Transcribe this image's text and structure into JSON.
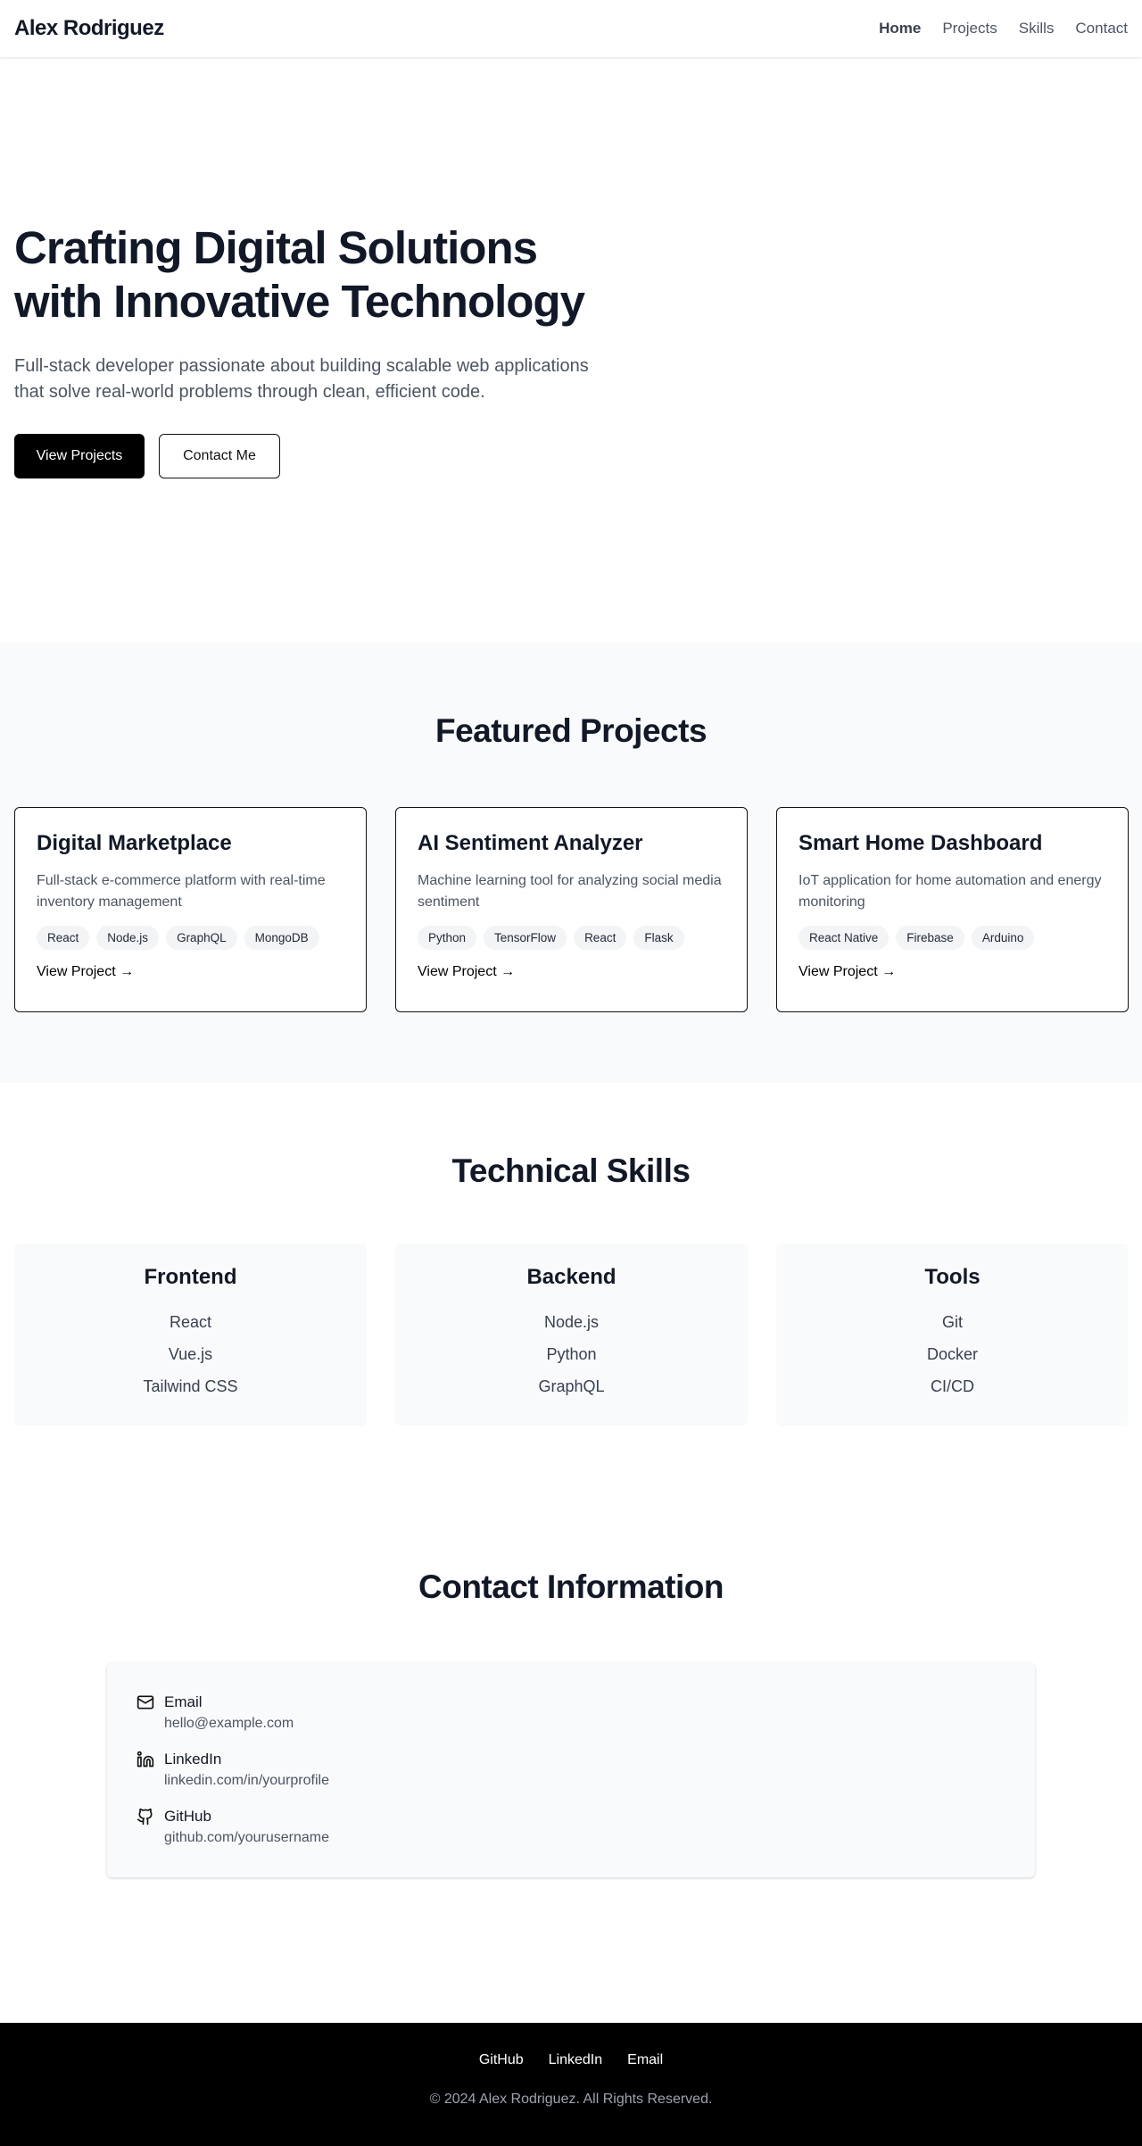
{
  "header": {
    "brand": "Alex Rodriguez",
    "nav": [
      {
        "label": "Home"
      },
      {
        "label": "Projects"
      },
      {
        "label": "Skills"
      },
      {
        "label": "Contact"
      }
    ]
  },
  "hero": {
    "title_line1": "Crafting Digital Solutions",
    "title_line2": "with Innovative Technology",
    "subtitle": "Full-stack developer passionate about building scalable web applications that solve real-world problems through clean, efficient code.",
    "primary_button": "View Projects",
    "secondary_button": "Contact Me"
  },
  "projects": {
    "title": "Featured Projects",
    "items": [
      {
        "title": "Digital Marketplace",
        "description": "Full-stack e-commerce platform with real-time inventory management",
        "tags": [
          "React",
          "Node.js",
          "GraphQL",
          "MongoDB"
        ],
        "link": "View Project →"
      },
      {
        "title": "AI Sentiment Analyzer",
        "description": "Machine learning tool for analyzing social media sentiment",
        "tags": [
          "Python",
          "TensorFlow",
          "React",
          "Flask"
        ],
        "link": "View Project →"
      },
      {
        "title": "Smart Home Dashboard",
        "description": "IoT application for home automation and energy monitoring",
        "tags": [
          "React Native",
          "Firebase",
          "Arduino"
        ],
        "link": "View Project →"
      }
    ]
  },
  "skills": {
    "title": "Technical Skills",
    "groups": [
      {
        "title": "Frontend",
        "items": [
          "React",
          "Vue.js",
          "Tailwind CSS"
        ]
      },
      {
        "title": "Backend",
        "items": [
          "Node.js",
          "Python",
          "GraphQL"
        ]
      },
      {
        "title": "Tools",
        "items": [
          "Git",
          "Docker",
          "CI/CD"
        ]
      }
    ]
  },
  "contact": {
    "title": "Contact Information",
    "items": [
      {
        "icon": "mail-icon",
        "label": "Email",
        "value": "hello@example.com"
      },
      {
        "icon": "linkedin-icon",
        "label": "LinkedIn",
        "value": "linkedin.com/in/yourprofile"
      },
      {
        "icon": "github-icon",
        "label": "GitHub",
        "value": "github.com/yourusername"
      }
    ]
  },
  "footer": {
    "links": [
      "GitHub",
      "LinkedIn",
      "Email"
    ],
    "copyright": "© 2024 Alex Rodriguez. All Rights Reserved."
  }
}
